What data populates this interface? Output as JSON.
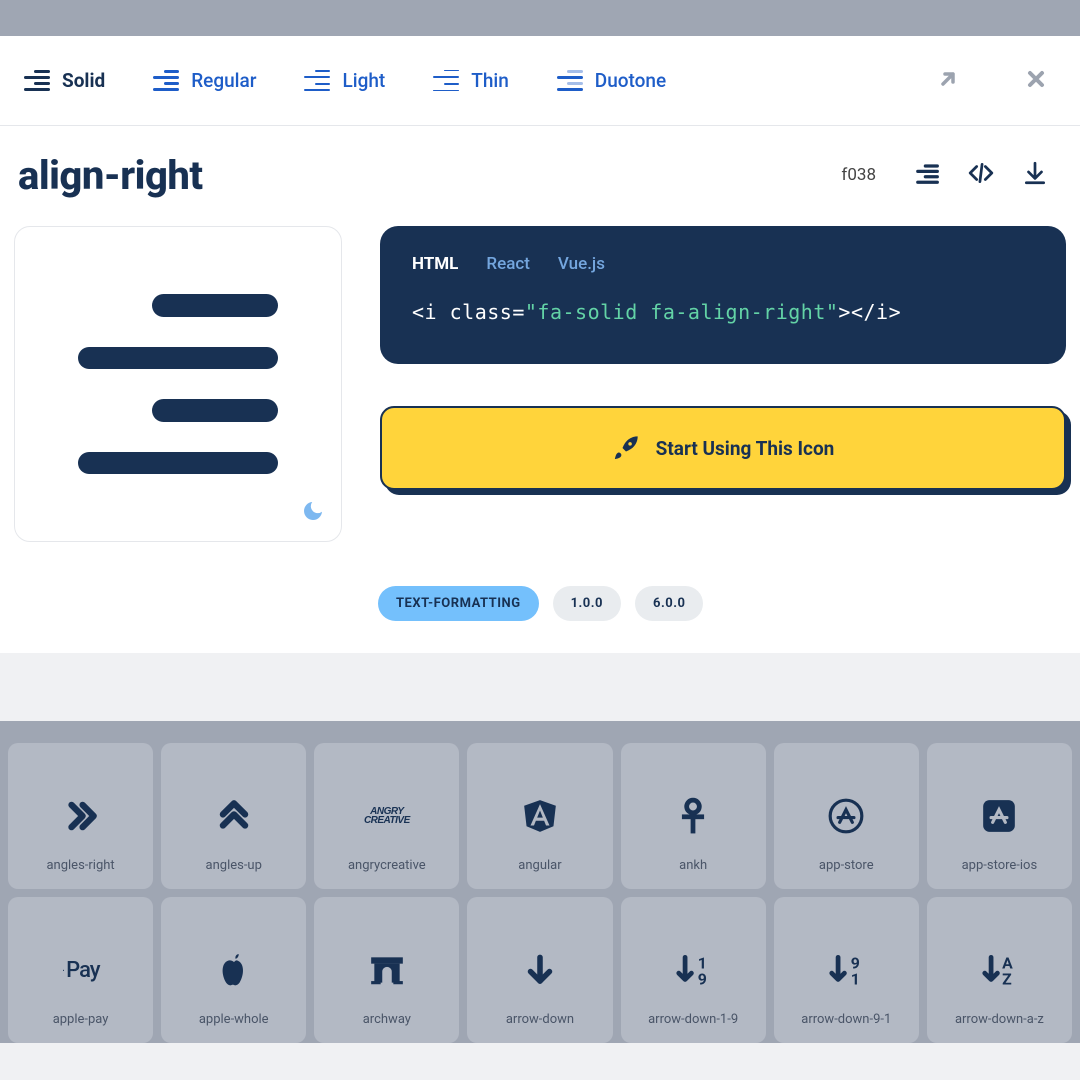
{
  "styleTabs": {
    "solid": "Solid",
    "regular": "Regular",
    "light": "Light",
    "thin": "Thin",
    "duotone": "Duotone"
  },
  "icon": {
    "name": "align-right",
    "unicode": "f038"
  },
  "codeTabs": {
    "html": "HTML",
    "react": "React",
    "vue": "Vue.js"
  },
  "codeSnippet": {
    "open": "<i class=",
    "cls": "\"fa-solid fa-align-right\"",
    "close": "></i>"
  },
  "cta": "Start Using This Icon",
  "tags": {
    "category": "TEXT-FORMATTING",
    "v1": "1.0.0",
    "v2": "6.0.0"
  },
  "gridIcons": [
    "angles-right",
    "angles-up",
    "angrycreative",
    "angular",
    "ankh",
    "app-store",
    "app-store-ios",
    "apple-pay",
    "apple-whole",
    "archway",
    "arrow-down",
    "arrow-down-1-9",
    "arrow-down-9-1",
    "arrow-down-a-z"
  ]
}
